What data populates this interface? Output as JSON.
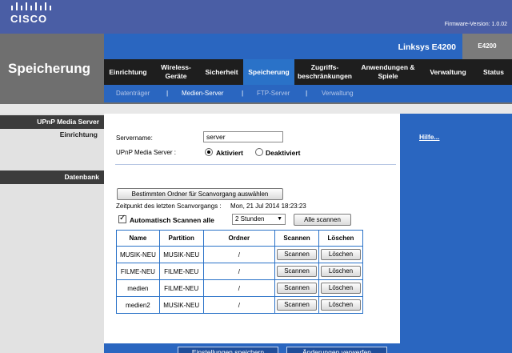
{
  "header": {
    "brand": "CISCO",
    "firmware_label": "Firmware-Version:",
    "firmware_value": "1.0.02",
    "product_name": "Linksys E4200",
    "model": "E4200",
    "section_title": "Speicherung"
  },
  "nav": {
    "tabs": [
      {
        "label": "Einrichtung"
      },
      {
        "label": "Wireless-\nGeräte"
      },
      {
        "label": "Sicherheit"
      },
      {
        "label": "Speicherung"
      },
      {
        "label": "Zugriffs-\nbeschränkungen"
      },
      {
        "label": "Anwendungen &\nSpiele"
      },
      {
        "label": "Verwaltung"
      },
      {
        "label": "Status"
      }
    ],
    "active_tab": "Speicherung",
    "subtabs": [
      {
        "label": "Datenträger"
      },
      {
        "label": "Medien-Server"
      },
      {
        "label": "FTP-Server"
      },
      {
        "label": "Verwaltung"
      }
    ],
    "separator": "|",
    "active_subtab": "Medien-Server"
  },
  "sidebar": {
    "upnp_heading": "UPnP Media Server",
    "upnp_sub": "Einrichtung",
    "db_heading": "Datenbank"
  },
  "help": {
    "link": "Hilfe..."
  },
  "form": {
    "servername_label": "Servername:",
    "servername_value": "server",
    "upnp_label": "UPnP Media Server :",
    "radio_on": "Aktiviert",
    "radio_off": "Deaktiviert",
    "upnp_state": "Aktiviert",
    "folder_button": "Bestimmten Ordner für Scanvorgang auswählen",
    "lastscan_label": "Zeitpunkt des letzten Scanvorgangs :",
    "lastscan_value": "Mon, 21 Jul 2014 18:23:23",
    "autoscan_label": "Automatisch Scannen alle",
    "autoscan_checked": true,
    "interval_value": "2 Stunden",
    "scan_all_button": "Alle scannen"
  },
  "table": {
    "headers": [
      "Name",
      "Partition",
      "Ordner",
      "Scannen",
      "Löschen"
    ],
    "rows": [
      {
        "name": "MUSIK-NEU",
        "partition": "MUSIK-NEU",
        "folder": "/",
        "scan": "Scannen",
        "delete": "Löschen"
      },
      {
        "name": "FILME-NEU",
        "partition": "FILME-NEU",
        "folder": "/",
        "scan": "Scannen",
        "delete": "Löschen"
      },
      {
        "name": "medien",
        "partition": "FILME-NEU",
        "folder": "/",
        "scan": "Scannen",
        "delete": "Löschen"
      },
      {
        "name": "medien2",
        "partition": "MUSIK-NEU",
        "folder": "/",
        "scan": "Scannen",
        "delete": "Löschen"
      }
    ]
  },
  "footer": {
    "save_button": "Einstellungen speichern",
    "cancel_button": "Änderungen verwerfen"
  },
  "colors": {
    "top_blue": "#4a5ea5",
    "accent_blue": "#2a66c0",
    "active_tab": "#2a72c8",
    "nav_dark": "#1e1e1e",
    "band_gray": "#6f6f6f"
  }
}
